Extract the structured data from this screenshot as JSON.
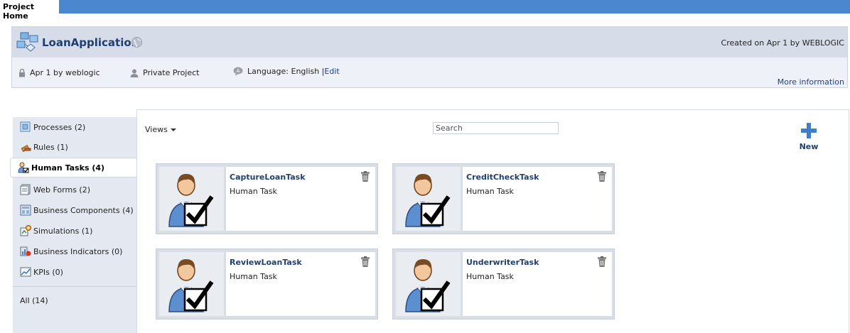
{
  "top_tab": {
    "label": "Project Home"
  },
  "project": {
    "title": "LoanApplication",
    "created": "Created on Apr 1 by WEBLOGIC",
    "lock_text": "Apr 1 by weblogic",
    "visibility": "Private Project",
    "language_label": "Language: English | ",
    "edit_link": "Edit",
    "more_info": "More information"
  },
  "sidebar": {
    "items": [
      {
        "label": "Processes (2)",
        "icon": "processes-icon"
      },
      {
        "label": "Rules (1)",
        "icon": "rules-icon"
      },
      {
        "label": "Human Tasks (4)",
        "icon": "human-tasks-icon",
        "active": true
      },
      {
        "label": "Web Forms (2)",
        "icon": "web-forms-icon"
      },
      {
        "label": "Business Components (4)",
        "icon": "business-components-icon"
      },
      {
        "label": "Simulations (1)",
        "icon": "simulations-icon"
      },
      {
        "label": "Business Indicators (0)",
        "icon": "business-indicators-icon"
      },
      {
        "label": "KPIs (0)",
        "icon": "kpis-icon"
      }
    ],
    "all": "All (14)"
  },
  "toolbar": {
    "views": "Views",
    "search_placeholder": "Search",
    "new_label": "New"
  },
  "cards": [
    {
      "name": "CaptureLoanTask",
      "type": "Human Task"
    },
    {
      "name": "CreditCheckTask",
      "type": "Human Task"
    },
    {
      "name": "ReviewLoanTask",
      "type": "Human Task"
    },
    {
      "name": "UnderwriterTask",
      "type": "Human Task"
    }
  ],
  "colors": {
    "top_bar": "#4a87cf",
    "link": "#1f3f73",
    "sidebar_bg": "#e4e9f1",
    "header_title_bg": "#d7dde8"
  }
}
